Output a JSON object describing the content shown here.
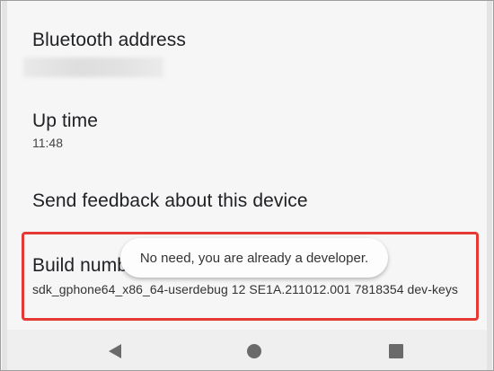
{
  "settings": {
    "bluetooth": {
      "title": "Bluetooth address"
    },
    "uptime": {
      "title": "Up time",
      "value": "11:48"
    },
    "feedback": {
      "title": "Send feedback about this device"
    },
    "build": {
      "title": "Build number",
      "value": "sdk_gphone64_x86_64-userdebug 12 SE1A.211012.001 7818354 dev-keys"
    }
  },
  "toast": {
    "message": "No need, you are already a developer."
  },
  "navbar": {
    "back_icon": "back-triangle-icon",
    "home_icon": "home-circle-icon",
    "recents_icon": "recents-square-icon"
  },
  "colors": {
    "highlight": "#e53935",
    "background": "#f6f6f6",
    "navbar": "#efefef"
  }
}
